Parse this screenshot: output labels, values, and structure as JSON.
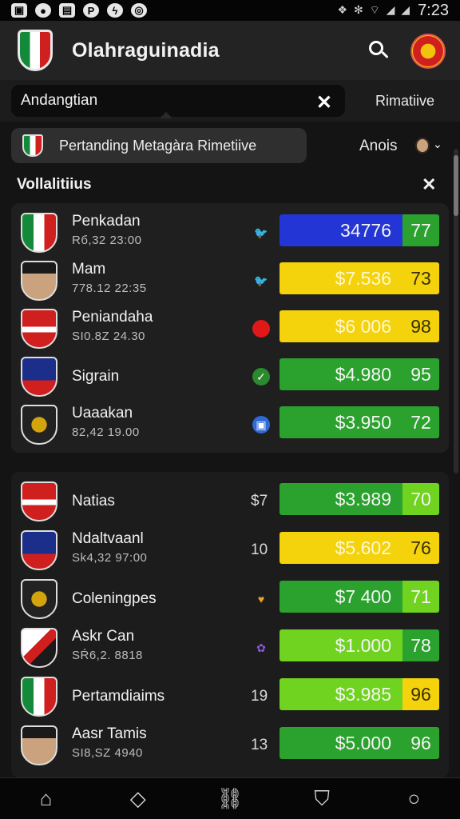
{
  "status": {
    "time": "7:23"
  },
  "app": {
    "title": "Olahraguinadia"
  },
  "tabs": {
    "search_text": "Andangtian",
    "right_tab": "Rimatiive"
  },
  "filter": {
    "label": "Pertanding Metagàra Rimetiive",
    "right_label": "Anois"
  },
  "section": {
    "title": "Vollalitiius"
  },
  "colors": {
    "blue": "#2335d4",
    "yellow": "#f4d20c",
    "green": "#2aa22d",
    "lime": "#6fd31f"
  },
  "rows_top": [
    {
      "name": "Penkadan",
      "meta": "Rб,32  23:00",
      "icon": "twitter-icon",
      "value": "34776",
      "score": "77",
      "bar": "blue",
      "score_bg": "green"
    },
    {
      "name": "Mam",
      "meta": "778.12  22:35",
      "icon": "twitter-icon",
      "value": "$7.536",
      "score": "73",
      "bar": "yellow",
      "score_bg": "yellow"
    },
    {
      "name": "Penіandaha",
      "meta": "SI0.8Z  24.30",
      "icon": "red-dot-icon",
      "value": "$6 006",
      "score": "98",
      "bar": "yellow",
      "score_bg": "yellow"
    },
    {
      "name": "Sigrain",
      "meta": "",
      "icon": "check-icon",
      "value": "$4.980",
      "score": "95",
      "bar": "green",
      "score_bg": "green"
    },
    {
      "name": "Uaaakan",
      "meta": "82,42  19.00",
      "icon": "shield-badge-icon",
      "value": "$3.950",
      "score": "72",
      "bar": "green",
      "score_bg": "green"
    }
  ],
  "rows_bottom": [
    {
      "name": "Natias",
      "meta": "",
      "mid": "$7",
      "value": "$3.989",
      "score": "70",
      "bar": "green",
      "score_bg": "lime"
    },
    {
      "name": "Ndaltvaanl",
      "meta": "Sk4,32  97:00",
      "mid": "10",
      "value": "$5.602",
      "score": "76",
      "bar": "yellow",
      "score_bg": "yellow"
    },
    {
      "name": "Coleningpes",
      "meta": "",
      "mid": "",
      "value": "$7 400",
      "score": "71",
      "bar": "green",
      "score_bg": "lime"
    },
    {
      "name": "Askr Can",
      "meta": "SŔ6,2.  8818",
      "mid": "",
      "value": "$1.000",
      "score": "78",
      "bar": "lime",
      "score_bg": "green"
    },
    {
      "name": "Pertamdiaims",
      "meta": "",
      "mid": "19",
      "value": "$3.985",
      "score": "96",
      "bar": "lime",
      "score_bg": "yellow"
    },
    {
      "name": "Aasr Tamis",
      "meta": "SI8,SZ  4940",
      "mid": "13",
      "value": "$5.000",
      "score": "96",
      "bar": "green",
      "score_bg": "green"
    }
  ]
}
